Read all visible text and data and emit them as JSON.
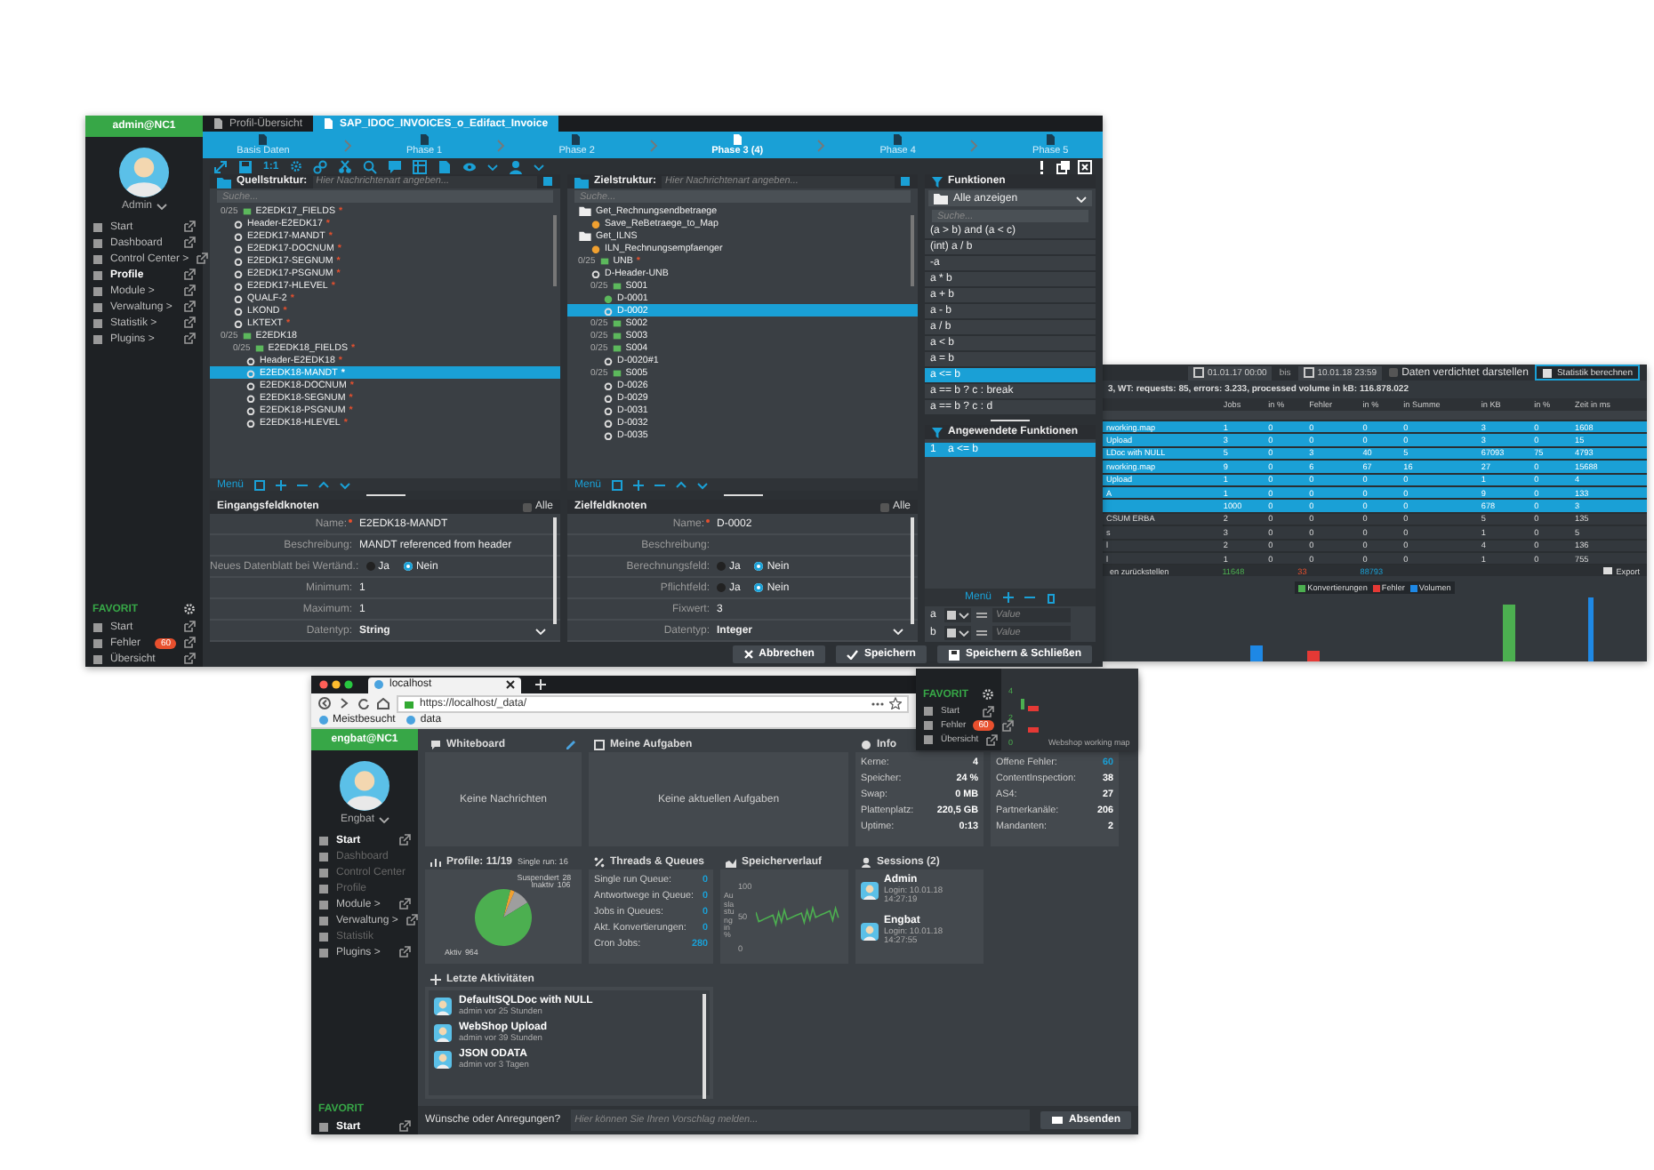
{
  "main_window": {
    "sidebar": {
      "user_bar": "admin@NC1",
      "user": "Admin",
      "items": [
        {
          "label": "Start",
          "selected": false
        },
        {
          "label": "Dashboard",
          "selected": false
        },
        {
          "label": "Control Center >",
          "selected": false
        },
        {
          "label": "Profile",
          "selected": true
        },
        {
          "label": "Module >",
          "selected": false
        },
        {
          "label": "Verwaltung >",
          "selected": false
        },
        {
          "label": "Statistik >",
          "selected": false
        },
        {
          "label": "Plugins >",
          "selected": false
        }
      ],
      "favorites_title": "FAVORIT",
      "favorites": [
        {
          "label": "Start"
        },
        {
          "label": "Fehler",
          "badge": "60"
        },
        {
          "label": "Übersicht"
        }
      ]
    },
    "tabs": [
      {
        "label": "Profil-Übersicht",
        "selected": false
      },
      {
        "label": "SAP_IDOC_INVOICES_o_Edifact_Invoice",
        "selected": true
      }
    ],
    "phases": [
      {
        "label": "Basis Daten",
        "selected": false
      },
      {
        "label": "Phase 1",
        "selected": false
      },
      {
        "label": "Phase 2",
        "selected": false
      },
      {
        "label": "Phase 3 (4)",
        "selected": true
      },
      {
        "label": "Phase 4",
        "selected": false
      },
      {
        "label": "Phase 5",
        "selected": false
      }
    ],
    "toolbar": {
      "zoom_label": "1:1"
    },
    "source": {
      "title": "Quellstruktur:",
      "placeholder": "Hier Nachrichtenart angeben...",
      "search_placeholder": "Suche...",
      "footer": "Menü",
      "tree": [
        {
          "label": "E2EDK17_FIELDS",
          "kind": "group",
          "counter": "0/25",
          "mark": "*",
          "selected": false,
          "children": [
            {
              "label": "Header-E2EDK17",
              "kind": "field",
              "mark": "*",
              "selected": false
            },
            {
              "label": "E2EDK17-MANDT",
              "kind": "field",
              "mark": "*",
              "selected": false
            },
            {
              "label": "E2EDK17-DOCNUM",
              "kind": "field",
              "mark": "*",
              "selected": false
            },
            {
              "label": "E2EDK17-SEGNUM",
              "kind": "field",
              "mark": "*",
              "selected": false
            },
            {
              "label": "E2EDK17-PSGNUM",
              "kind": "field",
              "mark": "*",
              "selected": false
            },
            {
              "label": "E2EDK17-HLEVEL",
              "kind": "field",
              "mark": "*",
              "selected": false
            },
            {
              "label": "QUALF-2",
              "kind": "field",
              "mark": "*",
              "selected": false
            },
            {
              "label": "LKOND",
              "kind": "field",
              "mark": "*",
              "selected": false
            },
            {
              "label": "LKTEXT",
              "kind": "field",
              "mark": "*",
              "selected": false
            }
          ]
        },
        {
          "label": "E2EDK18",
          "kind": "group",
          "counter": "0/25",
          "selected": false,
          "children": [
            {
              "label": "E2EDK18_FIELDS",
              "kind": "group",
              "counter": "0/25",
              "mark": "*",
              "selected": false,
              "children": [
                {
                  "label": "Header-E2EDK18",
                  "kind": "field",
                  "mark": "*",
                  "selected": false
                },
                {
                  "label": "E2EDK18-MANDT",
                  "kind": "field",
                  "mark": "*",
                  "selected": true
                },
                {
                  "label": "E2EDK18-DOCNUM",
                  "kind": "field",
                  "mark": "*",
                  "selected": false
                },
                {
                  "label": "E2EDK18-SEGNUM",
                  "kind": "field",
                  "mark": "*",
                  "selected": false
                },
                {
                  "label": "E2EDK18-PSGNUM",
                  "kind": "field",
                  "mark": "*",
                  "selected": false
                },
                {
                  "label": "E2EDK18-HLEVEL",
                  "kind": "field",
                  "mark": "*",
                  "selected": false
                }
              ]
            }
          ]
        }
      ]
    },
    "target": {
      "title": "Zielstruktur:",
      "placeholder": "Hier Nachrichtenart angeben...",
      "search_placeholder": "Suche...",
      "footer": "Menü",
      "tree": [
        {
          "label": "Get_Rechnungsendbetraege",
          "kind": "folder",
          "selected": false,
          "children": [
            {
              "label": "Save_ReBetraege_to_Map",
              "kind": "function",
              "selected": false
            }
          ]
        },
        {
          "label": "Get_ILNS",
          "kind": "folder",
          "selected": false,
          "children": [
            {
              "label": "ILN_Rechnungsempfaenger",
              "kind": "function",
              "selected": false
            }
          ]
        },
        {
          "label": "UNB",
          "kind": "group",
          "counter": "0/25",
          "mark": "*",
          "selected": false,
          "children": [
            {
              "label": "D-Header-UNB",
              "kind": "field",
              "selected": false
            },
            {
              "label": "S001",
              "kind": "group",
              "counter": "0/25",
              "selected": false,
              "children": [
                {
                  "label": "D-0001",
                  "kind": "mapped",
                  "selected": false
                },
                {
                  "label": "D-0002",
                  "kind": "field",
                  "selected": true
                }
              ]
            },
            {
              "label": "S002",
              "kind": "group",
              "counter": "0/25",
              "selected": false
            },
            {
              "label": "S003",
              "kind": "group",
              "counter": "0/25",
              "selected": false
            },
            {
              "label": "S004",
              "kind": "group",
              "counter": "0/25",
              "selected": false,
              "children": [
                {
                  "label": "D-0020#1",
                  "kind": "field",
                  "selected": false
                }
              ]
            },
            {
              "label": "S005",
              "kind": "group",
              "counter": "0/25",
              "selected": false,
              "children": [
                {
                  "label": "D-0026",
                  "kind": "field",
                  "selected": false
                },
                {
                  "label": "D-0029",
                  "kind": "field",
                  "selected": false
                },
                {
                  "label": "D-0031",
                  "kind": "field",
                  "selected": false
                },
                {
                  "label": "D-0032",
                  "kind": "field",
                  "selected": false
                },
                {
                  "label": "D-0035",
                  "kind": "field",
                  "selected": false
                }
              ]
            }
          ]
        }
      ]
    },
    "source_form": {
      "title": "Eingangsfeldknoten",
      "all_label": "Alle",
      "all_checked": false,
      "rows": [
        {
          "label": "Name:",
          "required": true,
          "kind": "text",
          "value": "E2EDK18-MANDT"
        },
        {
          "label": "Beschreibung:",
          "required": false,
          "kind": "text",
          "value": "MANDT referenced from header"
        },
        {
          "label": "Neues Datenblatt bei Wertänd.:",
          "required": false,
          "kind": "radio",
          "options": [
            {
              "label": "Ja",
              "selected": false
            },
            {
              "label": "Nein",
              "selected": true
            }
          ]
        },
        {
          "label": "Minimum:",
          "required": false,
          "kind": "text",
          "value": "1"
        },
        {
          "label": "Maximum:",
          "required": false,
          "kind": "text",
          "value": "1"
        },
        {
          "label": "Datentyp:",
          "required": false,
          "kind": "select",
          "value": "String"
        }
      ]
    },
    "target_form": {
      "title": "Zielfeldknoten",
      "all_label": "Alle",
      "all_checked": false,
      "rows": [
        {
          "label": "Name:",
          "required": true,
          "kind": "text",
          "value": "D-0002"
        },
        {
          "label": "Beschreibung:",
          "required": false,
          "kind": "text"
        },
        {
          "label": "Berechnungsfeld:",
          "required": false,
          "kind": "radio",
          "options": [
            {
              "label": "Ja",
              "selected": false
            },
            {
              "label": "Nein",
              "selected": true
            }
          ]
        },
        {
          "label": "Pflichtfeld:",
          "required": false,
          "kind": "radio",
          "options": [
            {
              "label": "Ja",
              "selected": false
            },
            {
              "label": "Nein",
              "selected": true
            }
          ]
        },
        {
          "label": "Fixwert:",
          "required": false,
          "kind": "text",
          "value": "3"
        },
        {
          "label": "Datentyp:",
          "required": false,
          "kind": "select",
          "value": "Integer"
        }
      ]
    },
    "functions": {
      "title": "Funktionen",
      "filter": "Alle anzeigen",
      "search_placeholder": "Suche...",
      "items": [
        {
          "label": "(a > b) and (a < c)",
          "selected": false
        },
        {
          "label": "(int) a / b",
          "selected": false
        },
        {
          "label": "-a",
          "selected": false
        },
        {
          "label": "a * b",
          "selected": false
        },
        {
          "label": "a + b",
          "selected": false
        },
        {
          "label": "a - b",
          "selected": false
        },
        {
          "label": "a / b",
          "selected": false
        },
        {
          "label": "a < b",
          "selected": false
        },
        {
          "label": "a = b",
          "selected": false
        },
        {
          "label": "a <= b",
          "selected": true
        },
        {
          "label": "a == b ? c : break",
          "selected": false
        },
        {
          "label": "a == b ? c : d",
          "selected": false
        }
      ]
    },
    "applied": {
      "title": "Angewendete Funktionen",
      "items": [
        {
          "index": "1",
          "label": "a <= b",
          "selected": true
        }
      ]
    },
    "variables": {
      "menu": "Menü",
      "items": [
        {
          "name": "a",
          "placeholder": "Value"
        },
        {
          "name": "b",
          "placeholder": "Value"
        }
      ]
    },
    "buttons": [
      {
        "label": "Abbrechen",
        "kind": "cancel"
      },
      {
        "label": "Speichern",
        "kind": "save"
      },
      {
        "label": "Speichern & Schließen",
        "kind": "save_close"
      }
    ]
  },
  "stats_window": {
    "date_from": "01.01.17 00:00",
    "date_to_label": "bis",
    "date_to": "10.01.18 23:59",
    "compress_label": "Daten verdichtet darstellen",
    "compress_checked": false,
    "compute_button": "Statistik berechnen",
    "summary": "3, WT: requests: 85, errors: 3.233, processed volume in kB: 116.878.022",
    "table": {
      "columns": [
        "",
        "Jobs",
        "in %",
        "Fehler",
        "in %",
        "in Summe",
        "in KB",
        "in %",
        "Zeit in ms"
      ],
      "rows": [
        {
          "cells": [
            "rworking.map",
            "1",
            "0",
            "0",
            "0",
            "0",
            "3",
            "0",
            "1608"
          ],
          "selected": true
        },
        {
          "cells": [
            "Upload",
            "3",
            "0",
            "0",
            "0",
            "0",
            "3",
            "0",
            "15"
          ],
          "selected": true
        },
        {
          "cells": [
            "LDoc with NULL",
            "5",
            "0",
            "3",
            "40",
            "5",
            "67093",
            "75",
            "4793"
          ],
          "selected": true
        },
        {
          "cells": [
            "rworking.map",
            "9",
            "0",
            "6",
            "67",
            "16",
            "27",
            "0",
            "15688"
          ],
          "selected": true
        },
        {
          "cells": [
            "Upload",
            "1",
            "0",
            "0",
            "0",
            "0",
            "1",
            "0",
            "4"
          ],
          "selected": true
        },
        {
          "cells": [
            "A",
            "1",
            "0",
            "0",
            "0",
            "0",
            "9",
            "0",
            "133"
          ],
          "selected": true
        },
        {
          "cells": [
            "",
            "1000",
            "0",
            "0",
            "0",
            "0",
            "678",
            "0",
            "3"
          ],
          "selected": true
        },
        {
          "cells": [
            "CSUM ERBA",
            "2",
            "0",
            "0",
            "0",
            "0",
            "5",
            "0",
            "135"
          ],
          "selected": false
        },
        {
          "cells": [
            "s",
            "3",
            "0",
            "0",
            "0",
            "0",
            "1",
            "0",
            "5"
          ],
          "selected": false
        },
        {
          "cells": [
            "l",
            "2",
            "0",
            "0",
            "0",
            "0",
            "4",
            "0",
            "136"
          ],
          "selected": false
        },
        {
          "cells": [
            "l",
            "1",
            "0",
            "0",
            "0",
            "0",
            "1",
            "0",
            "755"
          ],
          "selected": false
        }
      ]
    },
    "footer": {
      "reset": "en zurückstellen",
      "total_jobs": "11648",
      "total_errors": "33",
      "total_volume": "88793",
      "export": "Export"
    },
    "legend": [
      {
        "label": "Konvertierungen",
        "color": "#4caf50"
      },
      {
        "label": "Fehler",
        "color": "#e53935"
      },
      {
        "label": "Volumen",
        "color": "#1e88e5"
      }
    ]
  },
  "fragment": {
    "favorites_title": "FAVORIT",
    "items": [
      {
        "label": "Start"
      },
      {
        "label": "Fehler",
        "badge": "60"
      },
      {
        "label": "Übersicht"
      }
    ],
    "ticks": [
      "4",
      "2",
      "0"
    ],
    "axis_label": "Webshop working map"
  },
  "dashboard_window": {
    "browser": {
      "tab": "localhost",
      "url": "https://localhost/_data/",
      "bookmarks": [
        "Meistbesucht",
        "data"
      ]
    },
    "sidebar": {
      "user_bar": "engbat@NC1",
      "user": "Engbat",
      "items": [
        {
          "label": "Start",
          "selected": true,
          "disabled": false
        },
        {
          "label": "Dashboard",
          "selected": false,
          "disabled": true
        },
        {
          "label": "Control Center",
          "selected": false,
          "disabled": true
        },
        {
          "label": "Profile",
          "selected": false,
          "disabled": true
        },
        {
          "label": "Module >",
          "selected": false,
          "disabled": false
        },
        {
          "label": "Verwaltung >",
          "selected": false,
          "disabled": false
        },
        {
          "label": "Statistik",
          "selected": false,
          "disabled": true
        },
        {
          "label": "Plugins >",
          "selected": false,
          "disabled": false
        }
      ],
      "favorites_title": "FAVORIT",
      "favorites": [
        {
          "label": "Start"
        }
      ]
    },
    "whiteboard": {
      "title": "Whiteboard",
      "empty": "Keine Nachrichten"
    },
    "tasks": {
      "title": "Meine Aufgaben",
      "empty": "Keine aktuellen Aufgaben"
    },
    "info": {
      "title": "Info",
      "rows": [
        {
          "label": "Kerne:",
          "value": "4"
        },
        {
          "label": "Speicher:",
          "value": "24 %"
        },
        {
          "label": "Swap:",
          "value": "0 MB"
        },
        {
          "label": "Plattenplatz:",
          "value": "220,5 GB"
        },
        {
          "label": "Uptime:",
          "value": "0:13"
        }
      ]
    },
    "counts": {
      "rows": [
        {
          "label": "Offene Fehler:",
          "value": "60"
        },
        {
          "label": "ContentInspection:",
          "value": "38"
        },
        {
          "label": "AS4:",
          "value": "27"
        },
        {
          "label": "Partnerkanäle:",
          "value": "206"
        },
        {
          "label": "Mandanten:",
          "value": "2"
        }
      ]
    },
    "profiles": {
      "title": "Profile: 11/19",
      "subtitle": "Single run: 16",
      "chart_data": {
        "type": "pie",
        "categories": [
          "Suspendiert",
          "Inaktiv",
          "Aktiv"
        ],
        "values": [
          28,
          106,
          964
        ],
        "data_labels": true
      }
    },
    "threads": {
      "title": "Threads & Queues",
      "rows": [
        {
          "label": "Single run Queue:",
          "value": "0"
        },
        {
          "label": "Antwortwege in Queue:",
          "value": "0"
        },
        {
          "label": "Jobs in Queues:",
          "value": "0"
        },
        {
          "label": "Akt. Konvertierungen:",
          "value": "0"
        },
        {
          "label": "Cron Jobs:",
          "value": "280"
        }
      ]
    },
    "memory": {
      "title": "Speicherverlauf",
      "ylabel": "Auslastung in %",
      "ticks": [
        "100",
        "50",
        "0"
      ]
    },
    "sessions": {
      "title": "Sessions (2)",
      "items": [
        {
          "user": "Admin",
          "login": "Login: 10.01.18 14:27:19"
        },
        {
          "user": "Engbat",
          "login": "Login: 10.01.18 14:27:55"
        }
      ]
    },
    "activities": {
      "title": "Letzte Aktivitäten",
      "items": [
        {
          "title": "DefaultSQLDoc with NULL",
          "meta": "admin vor 25 Stunden"
        },
        {
          "title": "WebShop Upload",
          "meta": "admin vor 39 Stunden"
        },
        {
          "title": "JSON ODATA",
          "meta": "admin vor 3 Tagen"
        }
      ]
    },
    "feedback": {
      "label": "Wünsche oder Anregungen?",
      "placeholder": "Hier können Sie Ihren Vorschlag melden...",
      "button": "Absenden"
    }
  }
}
